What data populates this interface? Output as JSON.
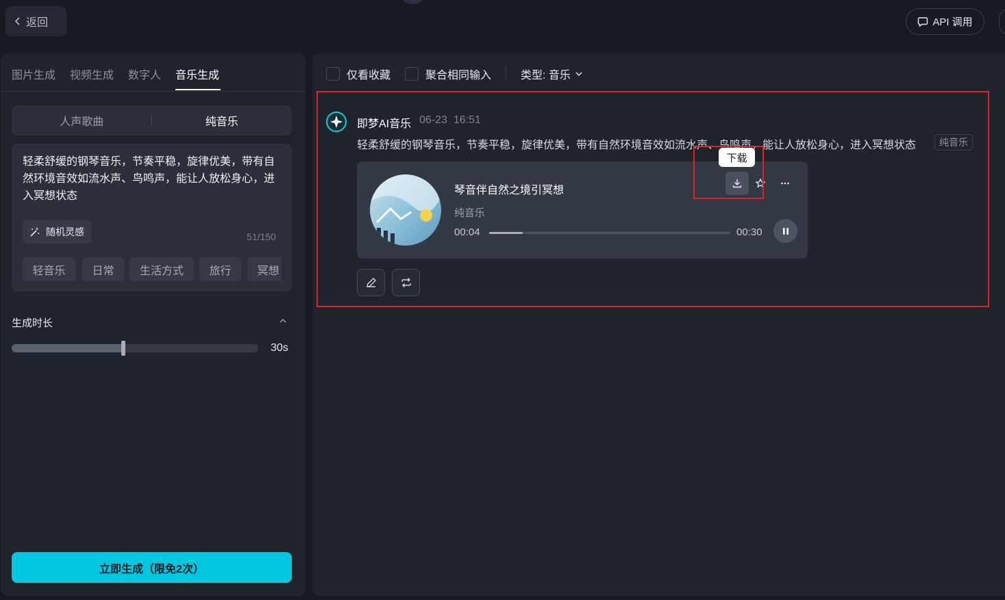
{
  "header": {
    "back_label": "返回",
    "api_label": "API 调用"
  },
  "left_panel": {
    "tabs": [
      {
        "label": "图片生成",
        "active": false
      },
      {
        "label": "视频生成",
        "active": false
      },
      {
        "label": "数字人",
        "active": false
      },
      {
        "label": "音乐生成",
        "active": true
      }
    ],
    "mode_options": [
      {
        "label": "人声歌曲",
        "active": false
      },
      {
        "label": "纯音乐",
        "active": true
      }
    ],
    "prompt_text": "轻柔舒缓的钢琴音乐，节奏平稳，旋律优美，带有自然环境音效如流水声、鸟鸣声，能让人放松身心，进入冥想状态",
    "inspiration_label": "随机灵感",
    "char_count": "51/150",
    "tags": [
      "轻音乐",
      "日常",
      "生活方式",
      "旅行",
      "冥想"
    ],
    "duration": {
      "title": "生成时长",
      "value_label": "30s",
      "fill_fraction": 0.45
    },
    "generate_label": "立即生成（限免2次）"
  },
  "main": {
    "filters": {
      "favorites_label": "仅看收藏",
      "merge_label": "聚合相同输入",
      "type_label": "类型: 音乐"
    },
    "result": {
      "author": "即梦AI音乐",
      "date": "06-23",
      "time": "16:51",
      "description": "轻柔舒缓的钢琴音乐，节奏平稳，旋律优美，带有自然环境音效如流水声、鸟鸣声，能让人放松身心，进入冥想状态",
      "tag": "纯音乐",
      "track": {
        "title": "琴音伴自然之境引冥想",
        "type": "纯音乐",
        "current_time": "00:04",
        "total_time": "00:30",
        "progress_fraction": 0.14
      },
      "tooltip": "下载"
    }
  },
  "colors": {
    "accent": "#00c8e0",
    "highlight_box": "#e02424",
    "panel_bg": "#1f232c"
  }
}
